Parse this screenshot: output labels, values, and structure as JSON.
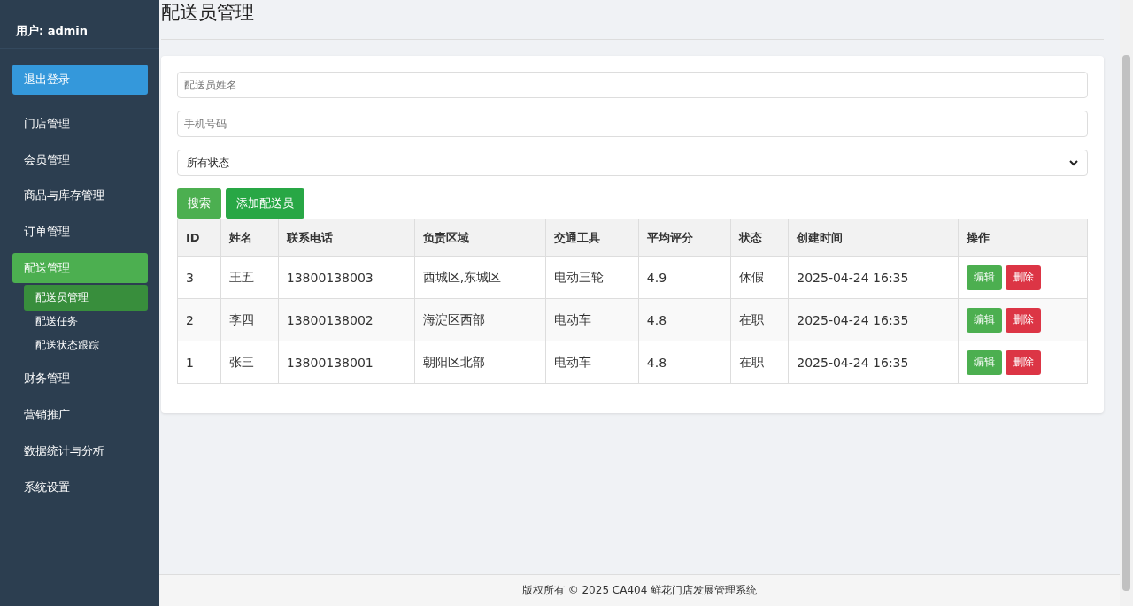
{
  "sidebar": {
    "user": "用户: admin",
    "logout": "退出登录",
    "items": [
      {
        "label": "门店管理",
        "selected": false
      },
      {
        "label": "会员管理",
        "selected": false
      },
      {
        "label": "商品与库存管理",
        "selected": false
      },
      {
        "label": "订单管理",
        "selected": false
      },
      {
        "label": "配送管理",
        "selected": true,
        "children": [
          {
            "label": "配送员管理",
            "selected": true
          },
          {
            "label": "配送任务",
            "selected": false
          },
          {
            "label": "配送状态跟踪",
            "selected": false
          }
        ]
      },
      {
        "label": "财务管理",
        "selected": false
      },
      {
        "label": "营销推广",
        "selected": false
      },
      {
        "label": "数据统计与分析",
        "selected": false
      },
      {
        "label": "系统设置",
        "selected": false
      }
    ]
  },
  "page_title": "配送员管理",
  "filters": {
    "name": {
      "placeholder": "配送员姓名"
    },
    "phone": {
      "placeholder": "手机号码"
    },
    "status": {
      "value": "所有状态"
    }
  },
  "buttons": {
    "search": "搜索",
    "add": "添加配送员"
  },
  "table": {
    "columns": [
      "ID",
      "姓名",
      "联系电话",
      "负责区域",
      "交通工具",
      "平均评分",
      "状态",
      "创建时间",
      "操作"
    ],
    "rows": [
      {
        "cells": [
          "3",
          "王五",
          "13800138003",
          "西城区,东城区",
          "电动三轮",
          "4.9",
          "休假",
          "2025-04-24 16:35"
        ],
        "actions": [
          "编辑",
          "删除"
        ]
      },
      {
        "cells": [
          "2",
          "李四",
          "13800138002",
          "海淀区西部",
          "电动车",
          "4.8",
          "在职",
          "2025-04-24 16:35"
        ],
        "actions": [
          "编辑",
          "删除"
        ]
      },
      {
        "cells": [
          "1",
          "张三",
          "13800138001",
          "朝阳区北部",
          "电动车",
          "4.8",
          "在职",
          "2025-04-24 16:35"
        ],
        "actions": [
          "编辑",
          "删除"
        ]
      }
    ]
  },
  "footer": "版权所有 © 2025 CA404 鲜花门店发展管理系统"
}
